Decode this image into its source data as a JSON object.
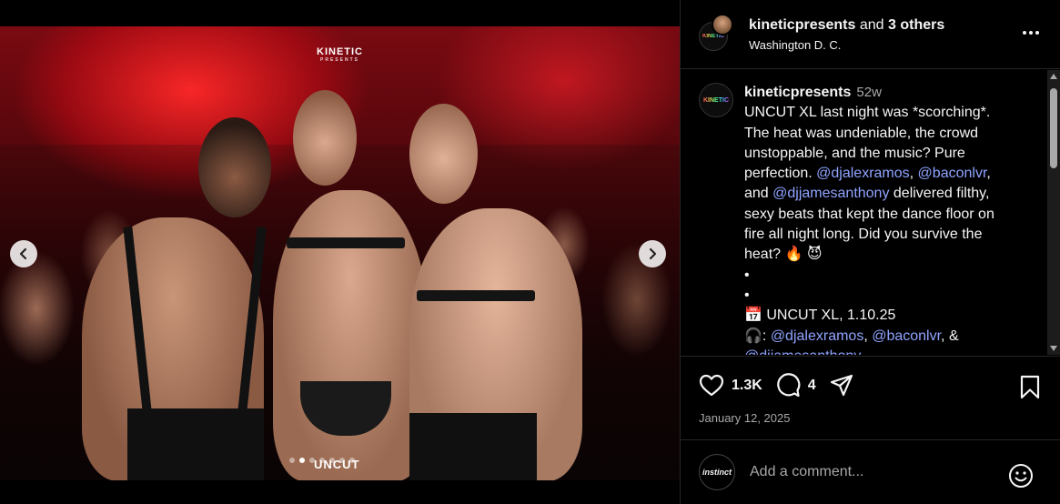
{
  "media": {
    "watermark_top": "KINETIC",
    "watermark_top_sub": "PRESENTS",
    "watermark_bottom": "UNCUT",
    "carousel": {
      "slide_count": 7,
      "active_index": 1
    }
  },
  "header": {
    "username": "kineticpresents",
    "collab_text": "and",
    "others": "3 others",
    "location": "Washington D. C.",
    "avatar_text": "KINETIC"
  },
  "caption": {
    "avatar_text": "KINETIC",
    "username": "kineticpresents",
    "age": "52w",
    "lines": [
      {
        "parts": [
          {
            "text": "UNCUT XL last night was *scorching*."
          }
        ]
      },
      {
        "parts": [
          {
            "text": "The heat was undeniable, the crowd"
          }
        ]
      },
      {
        "parts": [
          {
            "text": "unstoppable, and the music? Pure"
          }
        ]
      },
      {
        "parts": [
          {
            "text": "perfection. "
          },
          {
            "text": "@djalexramos",
            "mention": true
          },
          {
            "text": ", "
          },
          {
            "text": "@baconlvr",
            "mention": true
          },
          {
            "text": ","
          }
        ]
      },
      {
        "parts": [
          {
            "text": "and "
          },
          {
            "text": "@djjamesanthony",
            "mention": true
          },
          {
            "text": " delivered filthy,"
          }
        ]
      },
      {
        "parts": [
          {
            "text": "sexy beats that kept the dance floor on"
          }
        ]
      },
      {
        "parts": [
          {
            "text": "fire all night long. Did you survive the"
          }
        ]
      },
      {
        "parts": [
          {
            "text": "heat? 🔥 😈"
          }
        ]
      },
      {
        "parts": [
          {
            "text": "•"
          }
        ]
      },
      {
        "parts": [
          {
            "text": "•"
          }
        ]
      },
      {
        "parts": [
          {
            "text": "📅 UNCUT XL, 1.10.25"
          }
        ]
      },
      {
        "parts": [
          {
            "text": "🎧: "
          },
          {
            "text": "@djalexramos",
            "mention": true
          },
          {
            "text": ", "
          },
          {
            "text": "@baconlvr",
            "mention": true
          },
          {
            "text": ", &"
          }
        ]
      },
      {
        "parts": [
          {
            "text": "@djjamesanthony",
            "mention": true
          }
        ]
      }
    ]
  },
  "actions": {
    "likes": "1.3K",
    "comments": "4",
    "date": "January 12, 2025"
  },
  "comment_box": {
    "placeholder": "Add a comment...",
    "avatar_text": "instinct"
  }
}
